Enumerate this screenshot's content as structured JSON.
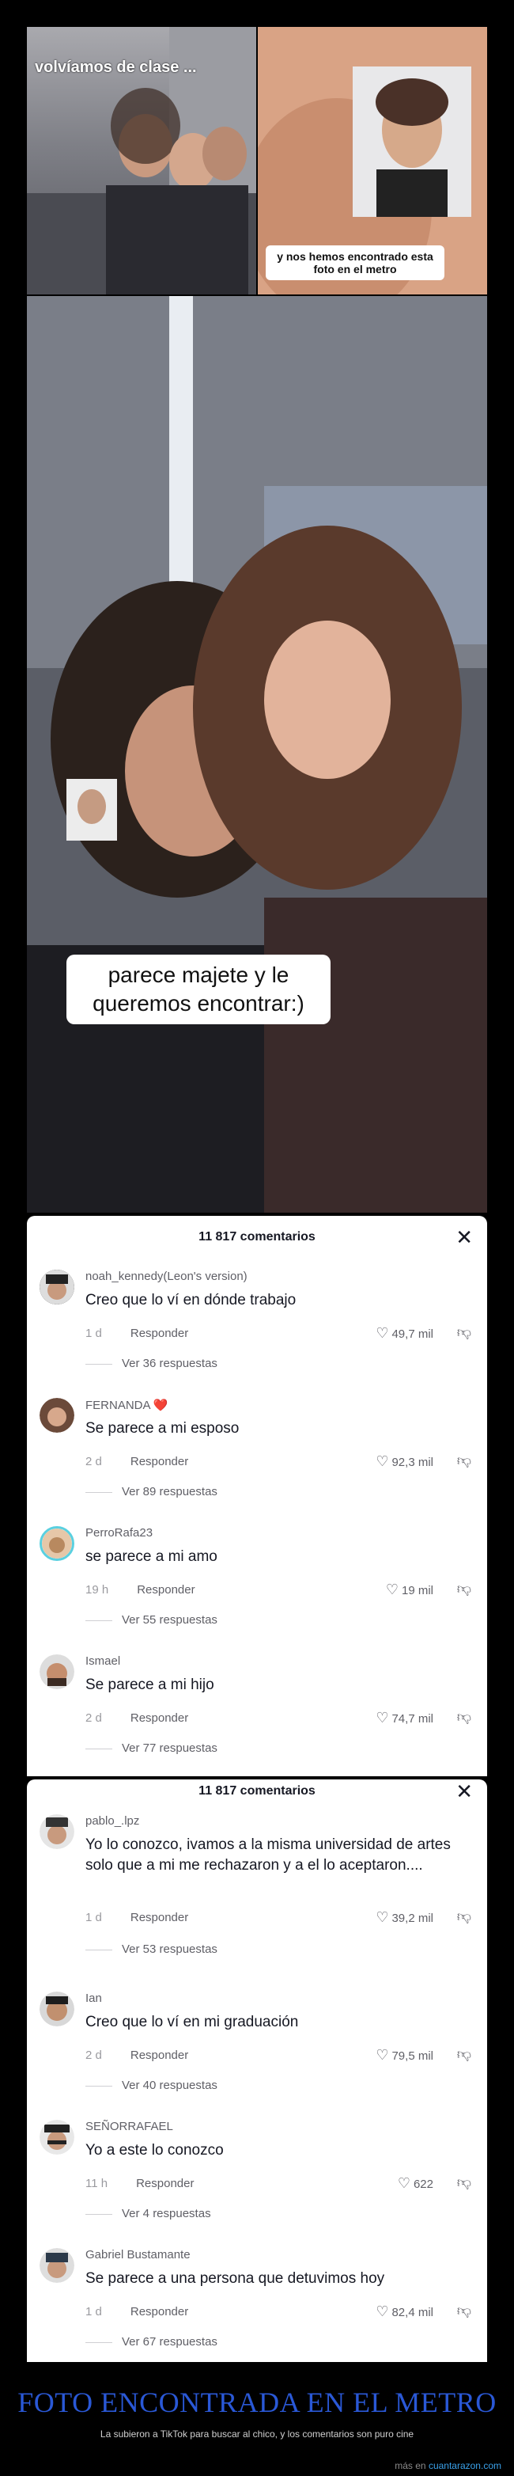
{
  "top_left": {
    "caption": "volvíamos de clase ..."
  },
  "top_right": {
    "caption": "y nos hemos encontrado esta foto en el metro"
  },
  "big_photo": {
    "caption": "parece majete y le queremos encontrar:)"
  },
  "panel1": {
    "count": "11 817 comentarios",
    "close": "✕",
    "comments": [
      {
        "user": "noah_kennedy(Leon's version)",
        "text": "Creo que lo ví en dónde trabajo",
        "age": "1 d",
        "reply": "Responder",
        "likes": "49,7 mil",
        "replies": "Ver 36 respuestas"
      },
      {
        "user": "FERNANDA ❤️",
        "text": "Se parece a mi esposo",
        "age": "2 d",
        "reply": "Responder",
        "likes": "92,3 mil",
        "replies": "Ver 89 respuestas"
      },
      {
        "user": "PerroRafa23",
        "text": "se parece a mi amo",
        "age": "19 h",
        "reply": "Responder",
        "likes": "19 mil",
        "replies": "Ver 55 respuestas"
      },
      {
        "user": "Ismael",
        "text": "Se parece a mi hijo",
        "age": "2 d",
        "reply": "Responder",
        "likes": "74,7 mil",
        "replies": "Ver 77 respuestas"
      }
    ]
  },
  "panel2": {
    "count": "11 817 comentarios",
    "close": "✕",
    "comments": [
      {
        "user": "pablo_.lpz",
        "text": "Yo lo conozco, ivamos a la misma universidad de artes solo que a mi me rechazaron y a el lo aceptaron....",
        "age": "1 d",
        "reply": "Responder",
        "likes": "39,2 mil",
        "replies": "Ver 53 respuestas"
      },
      {
        "user": "Ian",
        "text": "Creo que lo ví en mi graduación",
        "age": "2 d",
        "reply": "Responder",
        "likes": "79,5 mil",
        "replies": "Ver 40 respuestas"
      },
      {
        "user": "SEÑORRAFAEL",
        "text": "Yo a este lo conozco",
        "age": "11 h",
        "reply": "Responder",
        "likes": "622",
        "replies": "Ver 4 respuestas"
      },
      {
        "user": "Gabriel Bustamante",
        "text": "Se parece a una persona que detuvimos hoy",
        "age": "1 d",
        "reply": "Responder",
        "likes": "82,4 mil",
        "replies": "Ver 67 respuestas"
      }
    ]
  },
  "footer": {
    "title": "FOTO ENCONTRADA EN EL METRO",
    "subtitle": "La subieron a TikTok para buscar al chico, y los comentarios son puro cine",
    "site_prefix": "más en",
    "site": "cuantarazon.com"
  }
}
